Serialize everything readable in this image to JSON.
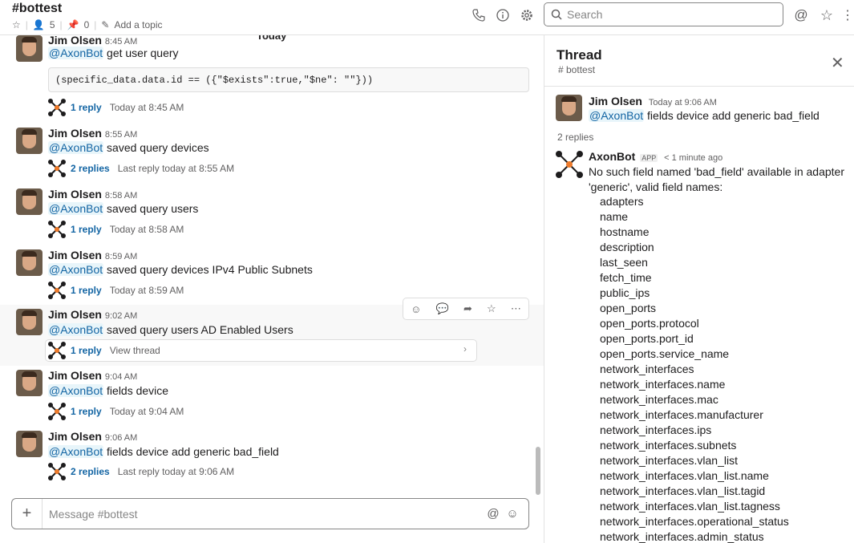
{
  "channel": {
    "name": "#bottest",
    "members": "5",
    "pins": "0",
    "topic_label": "Add a topic"
  },
  "search": {
    "placeholder": "Search"
  },
  "date_divider": "Today",
  "messages": [
    {
      "author": "Jim Olsen",
      "time": "8:45 AM",
      "mention": "@AxonBot",
      "text": "get user query",
      "code": "(specific_data.data.id == ({\"$exists\":true,\"$ne\": \"\"}))",
      "reply_count": "1 reply",
      "reply_time": "Today at 8:45 AM"
    },
    {
      "author": "Jim Olsen",
      "time": "8:55 AM",
      "mention": "@AxonBot",
      "text": "saved query devices",
      "reply_count": "2 replies",
      "reply_time": "Last reply today at 8:55 AM"
    },
    {
      "author": "Jim Olsen",
      "time": "8:58 AM",
      "mention": "@AxonBot",
      "text": "saved query users",
      "reply_count": "1 reply",
      "reply_time": "Today at 8:58 AM"
    },
    {
      "author": "Jim Olsen",
      "time": "8:59 AM",
      "mention": "@AxonBot",
      "text": "saved query devices IPv4 Public Subnets",
      "reply_count": "1 reply",
      "reply_time": "Today at 8:59 AM"
    },
    {
      "author": "Jim Olsen",
      "time": "9:02 AM",
      "mention": "@AxonBot",
      "text": "saved query users AD Enabled Users",
      "reply_count": "1 reply",
      "reply_time": "View thread"
    },
    {
      "author": "Jim Olsen",
      "time": "9:04 AM",
      "mention": "@AxonBot",
      "text": "fields device",
      "reply_count": "1 reply",
      "reply_time": "Today at 9:04 AM"
    },
    {
      "author": "Jim Olsen",
      "time": "9:06 AM",
      "mention": "@AxonBot",
      "text": "fields device add generic bad_field",
      "reply_count": "2 replies",
      "reply_time": "Last reply today at 9:06 AM"
    }
  ],
  "composer": {
    "placeholder": "Message #bottest"
  },
  "thread": {
    "title": "Thread",
    "channel": "# bottest",
    "parent": {
      "author": "Jim Olsen",
      "time": "Today at 9:06 AM",
      "mention": "@AxonBot",
      "text": "fields device add generic bad_field"
    },
    "replies_label": "2 replies",
    "reply": {
      "author": "AxonBot",
      "badge": "APP",
      "time": "< 1 minute ago",
      "line1": "No such field named 'bad_field' available in adapter",
      "line2": "'generic', valid field names:",
      "fields": [
        "adapters",
        "name",
        "hostname",
        "description",
        "last_seen",
        "fetch_time",
        "public_ips",
        "open_ports",
        "open_ports.protocol",
        "open_ports.port_id",
        "open_ports.service_name",
        "network_interfaces",
        "network_interfaces.name",
        "network_interfaces.mac",
        "network_interfaces.manufacturer",
        "network_interfaces.ips",
        "network_interfaces.subnets",
        "network_interfaces.vlan_list",
        "network_interfaces.vlan_list.name",
        "network_interfaces.vlan_list.tagid",
        "network_interfaces.vlan_list.tagness",
        "network_interfaces.operational_status",
        "network_interfaces.admin_status"
      ]
    }
  }
}
